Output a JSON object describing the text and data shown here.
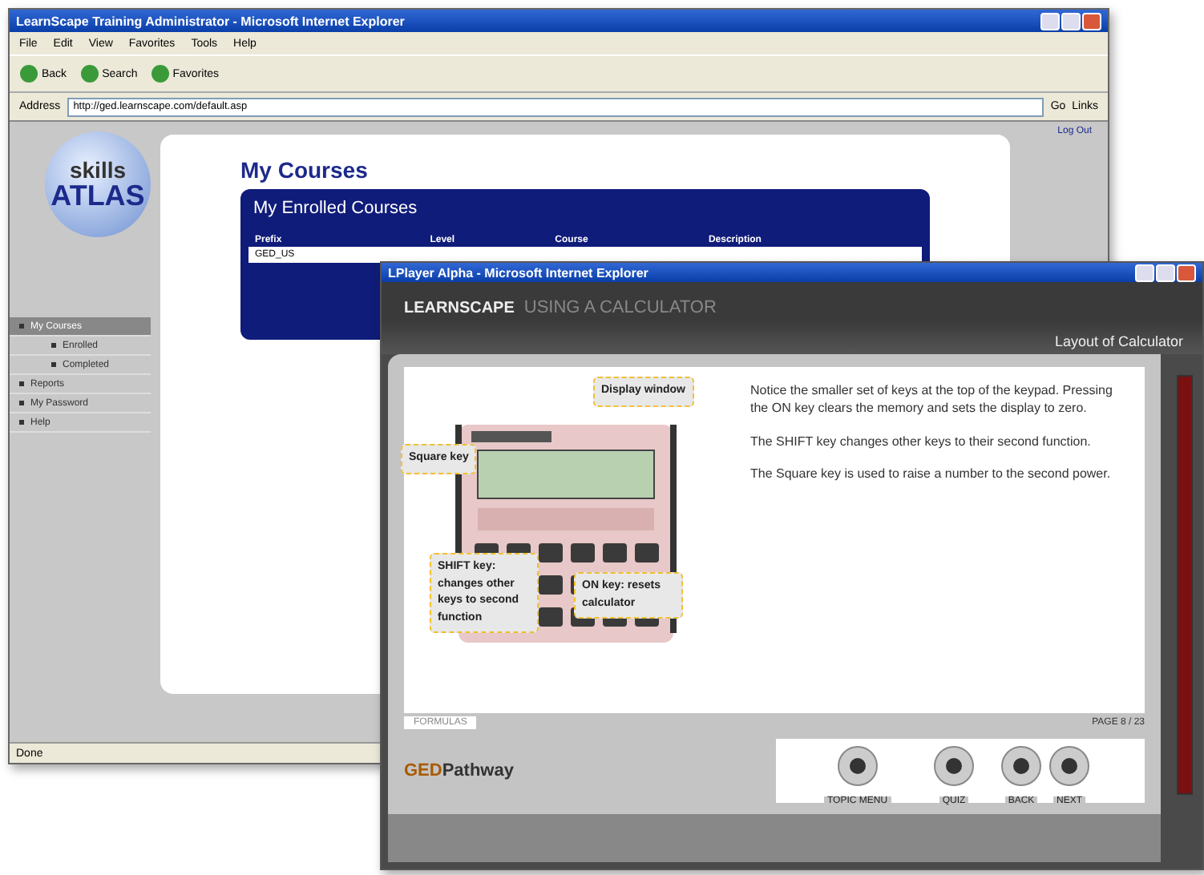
{
  "browser": {
    "title": "LearnScape Training Administrator - Microsoft Internet Explorer",
    "menu": [
      "File",
      "Edit",
      "View",
      "Favorites",
      "Tools",
      "Help"
    ],
    "toolbar": [
      {
        "label": "Back"
      },
      {
        "label": "Search"
      },
      {
        "label": "Favorites"
      }
    ],
    "address_label": "Address",
    "url": "http://ged.learnscape.com/default.asp",
    "go": "Go",
    "links": "Links",
    "log_out": "Log Out",
    "logo": {
      "top": "skills",
      "bottom": "ATLAS"
    },
    "sidebar": [
      {
        "label": "My Courses",
        "selected": true,
        "children": [
          {
            "label": "Enrolled",
            "selected": false
          },
          {
            "label": "Completed",
            "selected": false
          }
        ]
      },
      {
        "label": "Reports",
        "selected": false
      },
      {
        "label": "My Password",
        "selected": false
      },
      {
        "label": "Help",
        "selected": false
      }
    ],
    "page_title": "My Courses",
    "panel_title": "My Enrolled Courses",
    "table": {
      "columns": [
        "Prefix",
        "Level",
        "Course",
        "Description"
      ],
      "rows": [
        [
          "GED_US"
        ]
      ]
    },
    "status": "Done"
  },
  "player": {
    "title": "LPlayer Alpha - Microsoft Internet Explorer",
    "brand": "LEARNSCAPE",
    "course": "USING A CALCULATOR",
    "section": "Layout of Calculator",
    "callouts": [
      {
        "text": "Display window"
      },
      {
        "text": "Square key"
      },
      {
        "text": "SHIFT key: changes other keys to second function"
      },
      {
        "text": "ON key: resets calculator"
      }
    ],
    "paragraphs": [
      "Notice the smaller set of keys at the top of the keypad.  Pressing the ON key clears the memory and sets the display to zero.",
      "The SHIFT key changes other keys to their second function.",
      "The Square key is used to raise a number to the second power."
    ],
    "formulas": "FORMULAS",
    "page": "PAGE  8 / 23",
    "logo": {
      "prefix": "GED",
      "name": "Pathway"
    },
    "nav": [
      {
        "label": "TOPIC MENU"
      },
      {
        "label": "QUIZ"
      },
      {
        "label": "BACK"
      },
      {
        "label": "NEXT"
      }
    ]
  }
}
